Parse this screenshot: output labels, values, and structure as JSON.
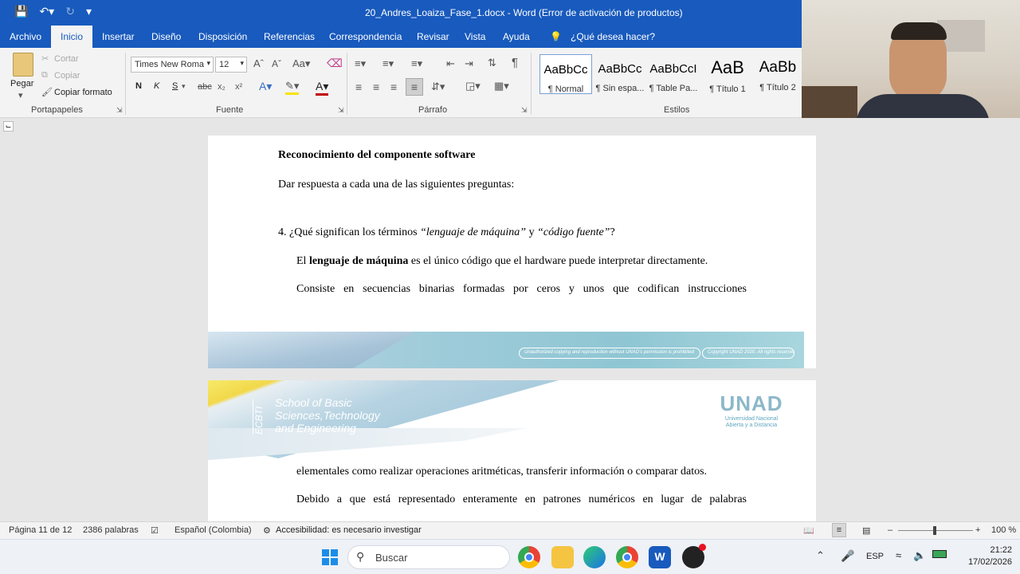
{
  "window": {
    "title": "20_Andres_Loaiza_Fase_1.docx  -  Word (Error de activación de productos)"
  },
  "tabs": [
    "Archivo",
    "Inicio",
    "Insertar",
    "Diseño",
    "Disposición",
    "Referencias",
    "Correspondencia",
    "Revisar",
    "Vista",
    "Ayuda"
  ],
  "tell_me": "¿Qué desea hacer?",
  "clipboard": {
    "paste": "Pegar",
    "cut": "Cortar",
    "copy": "Copiar",
    "format_painter": "Copiar formato",
    "group": "Portapapeles"
  },
  "font": {
    "name": "Times New Roma",
    "size": "12",
    "group": "Fuente",
    "bold": "N",
    "italic": "K",
    "underline": "S"
  },
  "paragraph": {
    "group": "Párrafo"
  },
  "styles": {
    "group": "Estilos",
    "items": [
      {
        "preview": "AaBbCc",
        "name": "¶ Normal"
      },
      {
        "preview": "AaBbCc",
        "name": "¶ Sin espa..."
      },
      {
        "preview": "AaBbCcI",
        "name": "¶ Table Pa..."
      },
      {
        "preview": "AaB",
        "name": "¶ Título 1"
      },
      {
        "preview": "AaBb",
        "name": "¶ Título 2"
      }
    ]
  },
  "document": {
    "heading": "Reconocimiento del componente software",
    "intro": "Dar respuesta a cada una de las siguientes preguntas:",
    "question_prefix": "4.  ¿Qué significan los términos ",
    "term1": "“lenguaje de máquina”",
    "question_mid": " y ",
    "term2": "“código fuente”",
    "question_end": "?",
    "p1_start": "El ",
    "p1_bold": "lenguaje de máquina",
    "p1_rest": " es el único código que el hardware puede interpretar directamente.",
    "p2": "Consiste en secuencias binarias formadas por ceros y unos que codifican instrucciones",
    "footer_notice": "Unauthorized copying and reproduction without UNAD's permission is prohibited",
    "footer_copyright": "Copyright UNAD 2020. All rights reserved",
    "header_ecbti": "ECBTI",
    "header_school_1": "School of Basic",
    "header_school_2": "Sciences,Technology",
    "header_school_3": "and Engineering",
    "unad_logo": "UNAD",
    "unad_sub_1": "Universidad Nacional",
    "unad_sub_2": "Abierta y a Distancia",
    "p3": "elementales como realizar operaciones aritméticas, transferir información o comparar datos.",
    "p4": "Debido a que está representado enteramente en patrones numéricos en lugar de palabras"
  },
  "status": {
    "page": "Página 11 de 12",
    "words": "2386 palabras",
    "language": "Español (Colombia)",
    "accessibility": "Accesibilidad: es necesario investigar",
    "zoom": "100 %"
  },
  "taskbar": {
    "search": "Buscar",
    "lang": "ESP",
    "time": "21:22",
    "date": "17/02/2026"
  },
  "colors": {
    "word_blue": "#185abd",
    "banner_teal": "#8fc9d6",
    "unad_yellow": "#f2c200"
  }
}
